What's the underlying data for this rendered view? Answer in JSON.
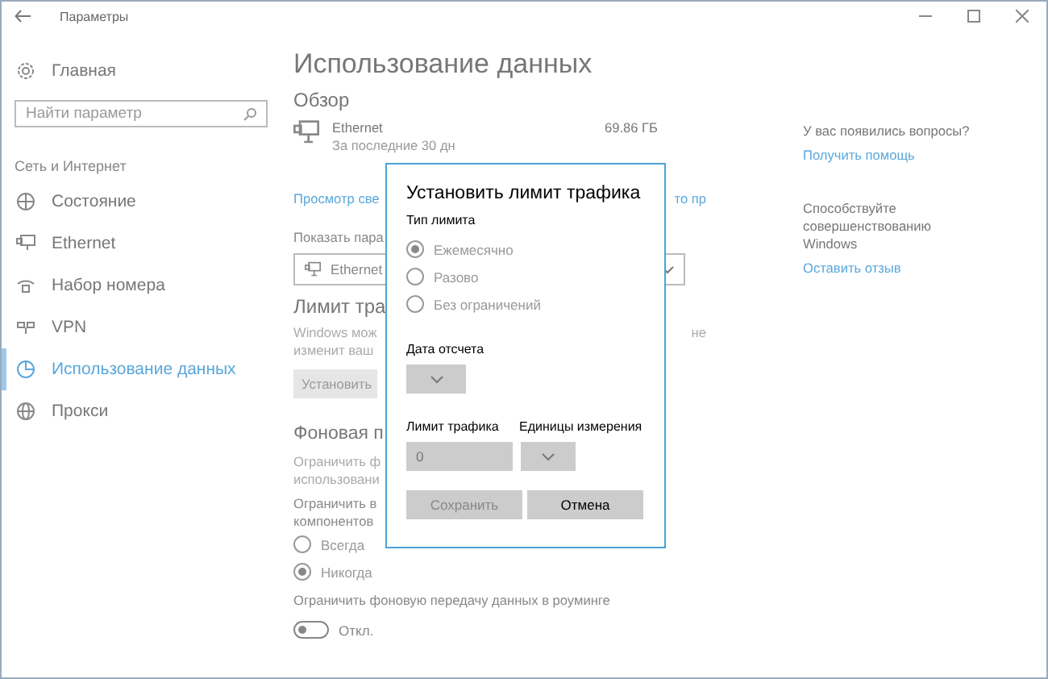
{
  "window": {
    "title": "Параметры"
  },
  "sidebar": {
    "home": "Главная",
    "search": {
      "placeholder": "Найти параметр"
    },
    "section": "Сеть и Интернет",
    "items": [
      {
        "label": "Состояние",
        "kind": "status",
        "selected": false
      },
      {
        "label": "Ethernet",
        "kind": "ethernet",
        "selected": false
      },
      {
        "label": "Набор номера",
        "kind": "dialup",
        "selected": false
      },
      {
        "label": "VPN",
        "kind": "vpn",
        "selected": false
      },
      {
        "label": "Использование данных",
        "kind": "data",
        "selected": true
      },
      {
        "label": "Прокси",
        "kind": "proxy",
        "selected": false
      }
    ]
  },
  "main": {
    "title": "Использование данных",
    "overview": "Обзор",
    "network": {
      "name": "Ethernet",
      "period": "За последние 30 дн",
      "usage": "69.86 ГБ"
    },
    "details_link": {
      "left": "Просмотр све",
      "right": "то пр"
    },
    "show_label": "Показать пара",
    "network_select": "Ethernet",
    "limit_heading": "Лимит тра",
    "limit_text": {
      "line_1": "Windows мож",
      "line_2": "изменит ваш",
      "right": "не"
    },
    "set_button": "Установить",
    "background_heading": "Фоновая п",
    "background_text": {
      "line_1": "Ограничить ф",
      "line_2": "использовани"
    },
    "restrict_text": {
      "line_1": "Ограничить в",
      "line_2": "компонентов"
    },
    "restrict_options": [
      {
        "label": "Всегда",
        "selected": false,
        "disabled": true
      },
      {
        "label": "Никогда",
        "selected": true,
        "disabled": true
      }
    ],
    "roaming": {
      "label": "Ограничить фоновую передачу данных в роуминге",
      "on": false,
      "state_text": "Откл."
    }
  },
  "help": {
    "question": "У вас появились вопросы?",
    "help_link": "Получить помощь",
    "improve": "Способствуйте совершенствованию Windows",
    "feedback_link": "Оставить отзыв"
  },
  "dialog": {
    "title": "Установить лимит трафика",
    "type_label": "Тип лимита",
    "types": [
      {
        "label": "Ежемесячно",
        "selected": true,
        "disabled": true
      },
      {
        "label": "Разово",
        "selected": false,
        "disabled": true
      },
      {
        "label": "Без ограничений",
        "selected": false,
        "disabled": true
      }
    ],
    "date_label": "Дата отсчета",
    "limit_label": "Лимит трафика",
    "limit_value": "0",
    "units_label": "Единицы измерения",
    "buttons": [
      {
        "label": "Сохранить",
        "disabled": true
      },
      {
        "label": "Отмена",
        "disabled": false
      }
    ]
  }
}
